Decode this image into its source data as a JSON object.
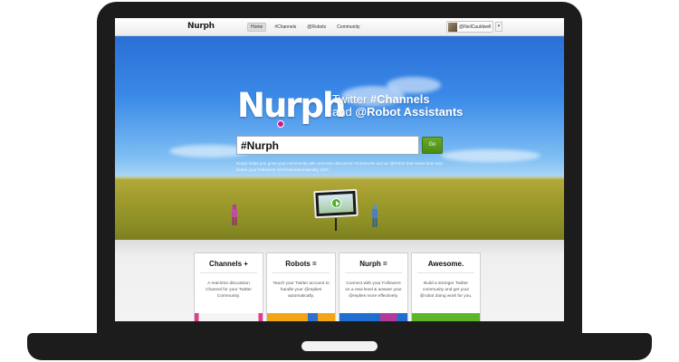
{
  "brand": "Nurph",
  "nav": {
    "items": [
      {
        "label": "Home",
        "active": true
      },
      {
        "label": "#Channels",
        "active": false
      },
      {
        "label": "@Robots",
        "active": false
      },
      {
        "label": "Community",
        "active": false
      }
    ],
    "user": {
      "name": "@NeilCauldwell",
      "caret": "▾"
    }
  },
  "hero": {
    "logo": "Nurph",
    "tagline_line1_prefix": "Twitter ",
    "tagline_line1_strong": "#Channels",
    "tagline_line2_prefix": "and ",
    "tagline_line2_strong": "@Robot Assistants",
    "search_value": "#Nurph",
    "go_label": "Go",
    "blurb": "Nurph helps you grow your community with real-time discussion #Channels and an @Robot that saves time and keeps your Followers informed automatically, 24/7."
  },
  "features": [
    {
      "title": "Channels +",
      "desc": "A real-time discussion Channel for your Twitter Community.",
      "art_color": "#e23a8f"
    },
    {
      "title": "Robots =",
      "desc": "Teach your Twitter account to handle your @replies automatically.",
      "art_color": "#f2a515"
    },
    {
      "title": "Nurph =",
      "desc": "Connect with your Followers on a new level & answer your @replies more effectively.",
      "art_color": "#1e6fcf"
    },
    {
      "title": "Awesome.",
      "desc": "Build a stronger Twitter community and get your @robot doing work for you.",
      "art_color": "#5db52a"
    }
  ],
  "colors": {
    "accent_green": "#4b8a16",
    "brand_magenta": "#d0158a",
    "sky_blue": "#3a8ae8"
  }
}
